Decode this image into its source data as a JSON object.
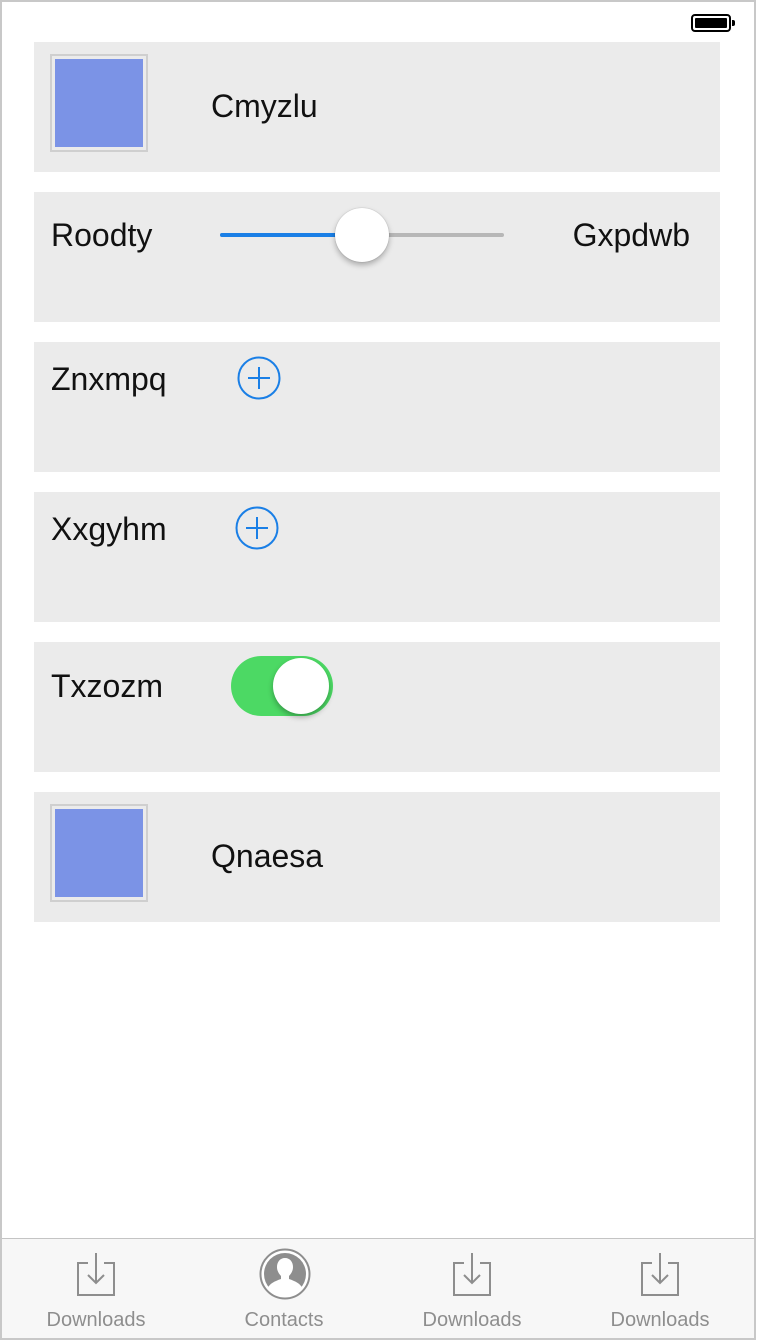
{
  "colors": {
    "row_background": "#ebebeb",
    "thumbnail_fill": "#7b93e6",
    "accent_blue": "#1a7fe6",
    "toggle_on": "#4cd964",
    "tab_inactive": "#8e8e8e"
  },
  "status_bar": {
    "battery_level": 1.0,
    "battery_icon": "battery-icon"
  },
  "rows": [
    {
      "type": "image-label",
      "label": "Cmyzlu"
    },
    {
      "type": "slider",
      "min_label": "Roodty",
      "max_label": "Gxpdwb",
      "value": 0.5
    },
    {
      "type": "add",
      "label": "Znxmpq",
      "icon": "add-circle-icon"
    },
    {
      "type": "add",
      "label": "Xxgyhm",
      "icon": "add-circle-icon"
    },
    {
      "type": "toggle",
      "label": "Txzozm",
      "on": true
    },
    {
      "type": "image-label",
      "label": "Qnaesa"
    }
  ],
  "tabbar": {
    "tabs": [
      {
        "label": "Downloads",
        "icon": "download-icon"
      },
      {
        "label": "Contacts",
        "icon": "contact-icon"
      },
      {
        "label": "Downloads",
        "icon": "download-icon"
      },
      {
        "label": "Downloads",
        "icon": "download-icon"
      }
    ]
  }
}
